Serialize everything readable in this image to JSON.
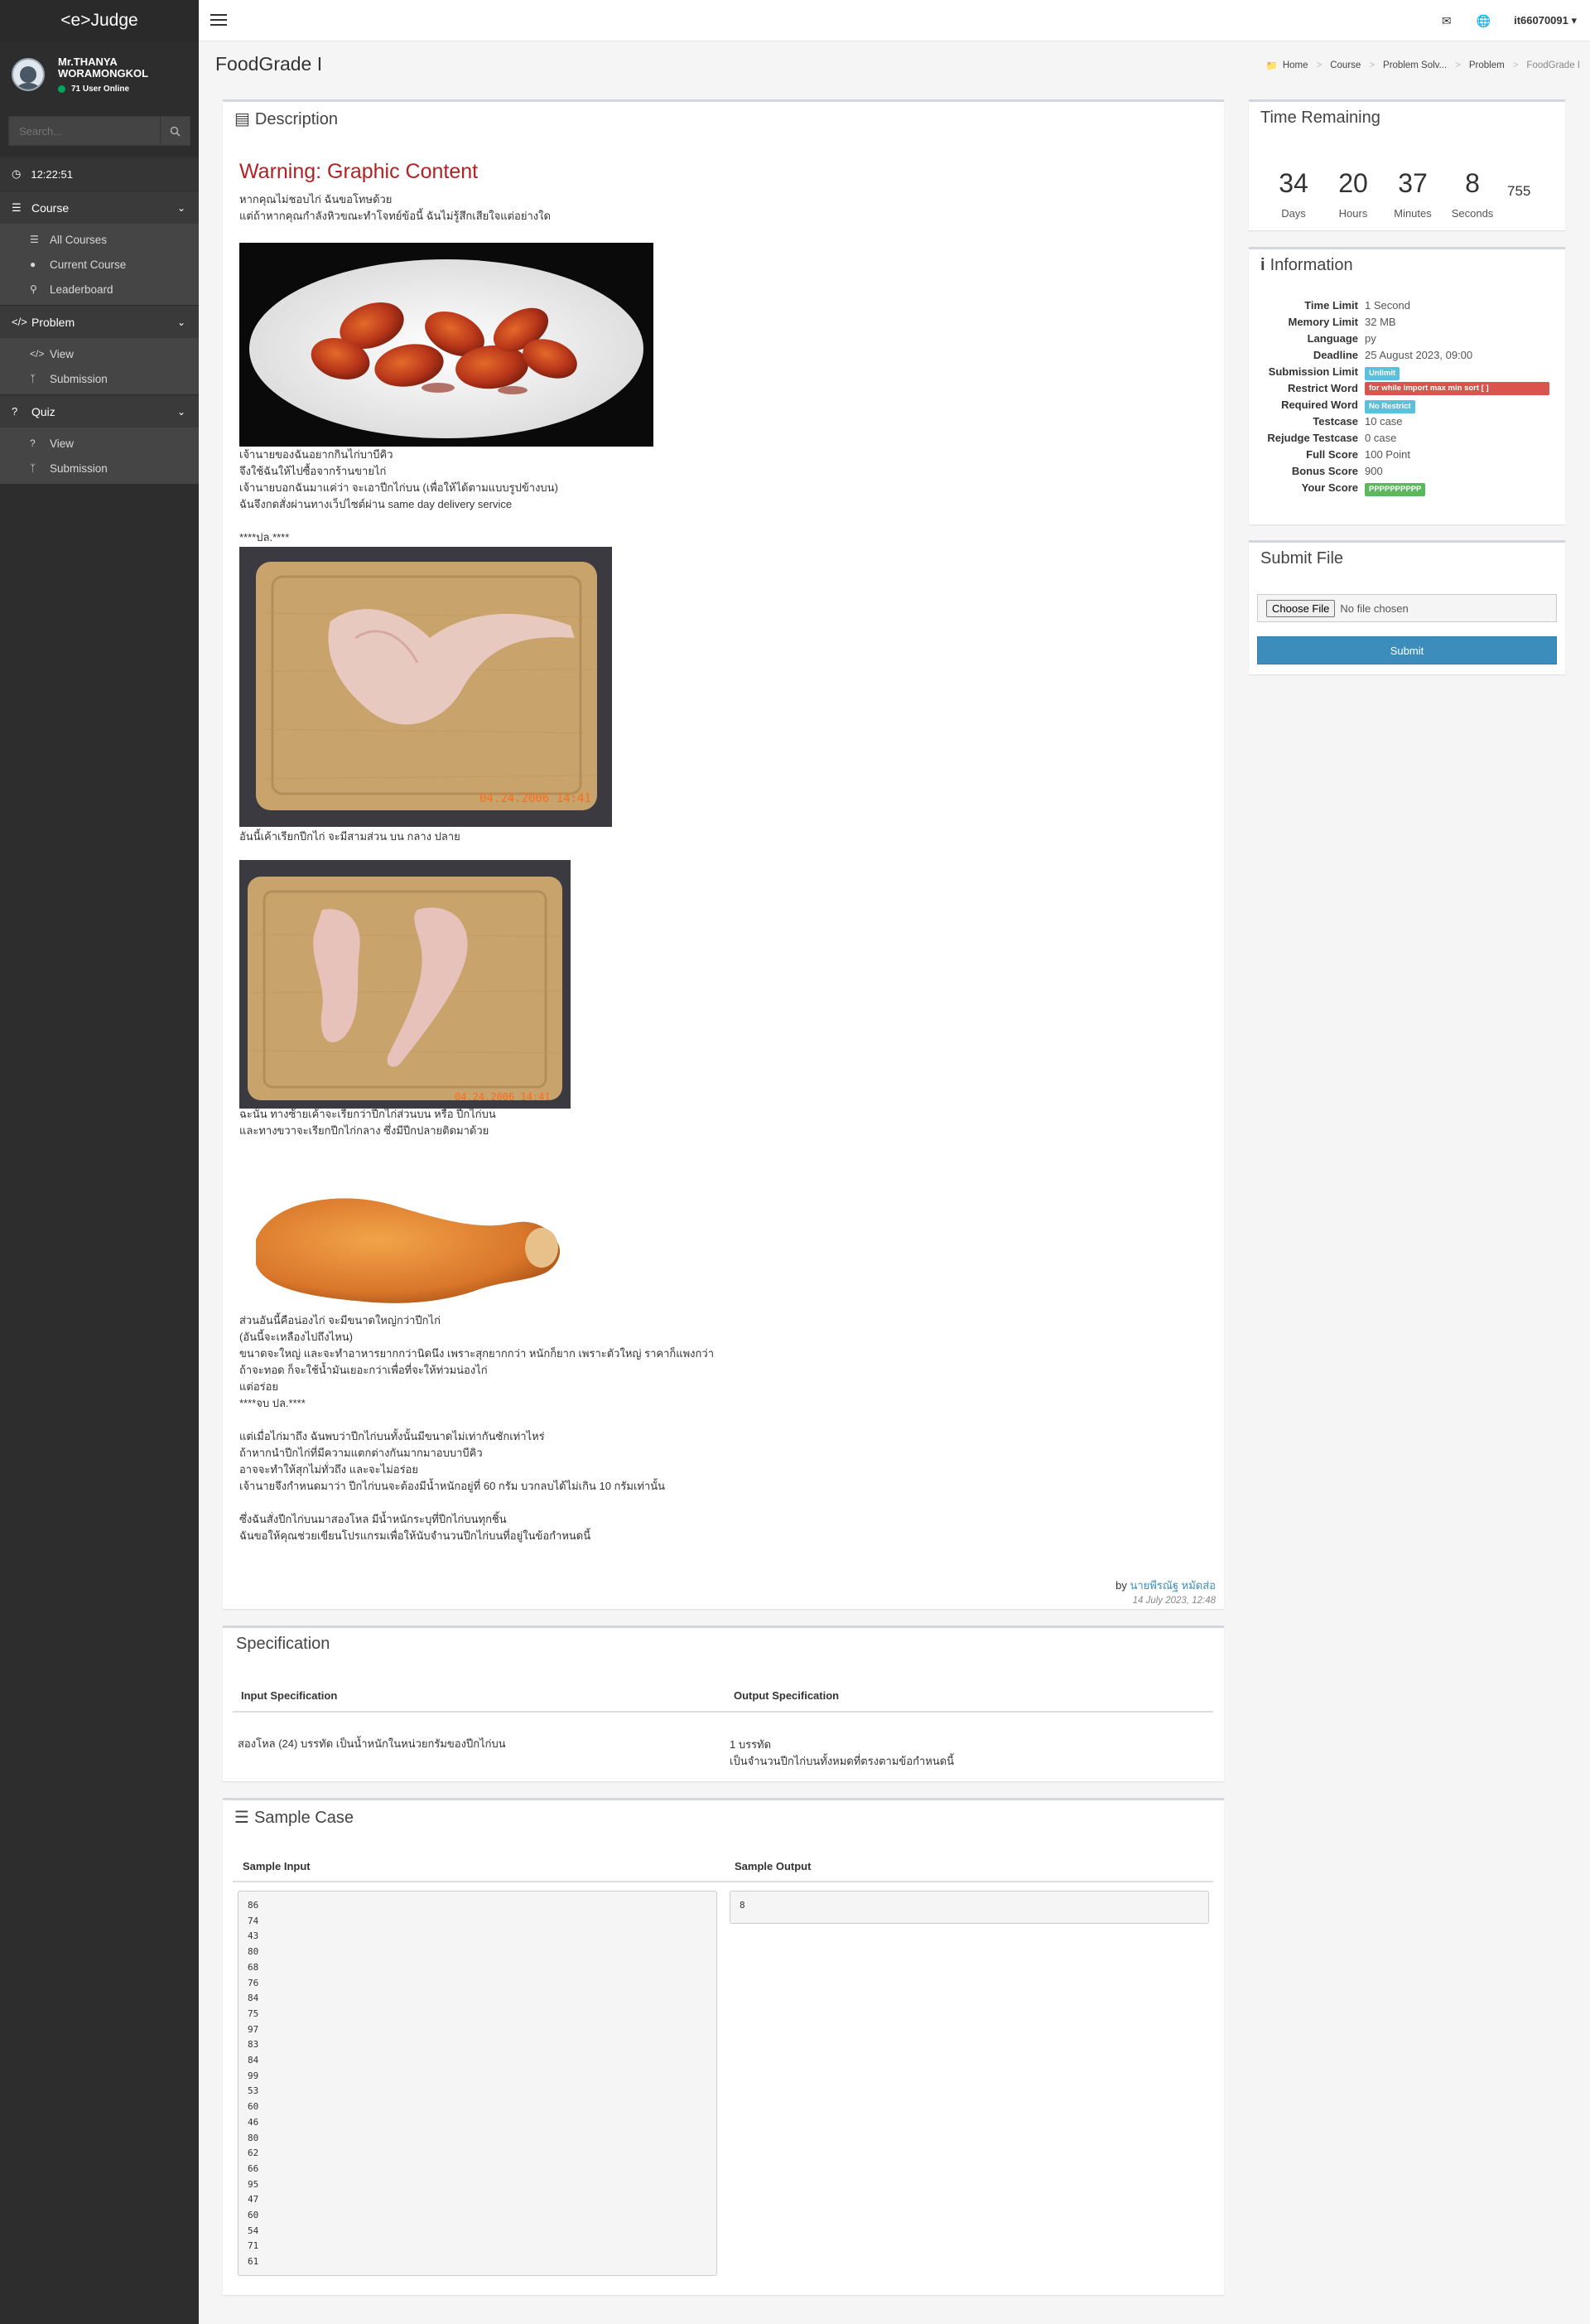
{
  "app": {
    "brand": "<e>Judge",
    "title": "FoodGrade I"
  },
  "user": {
    "name": "Mr.THANYA WORAMONGKOL",
    "online": "71 User Online",
    "username": "it66070091"
  },
  "search": {
    "placeholder": "Search..."
  },
  "clock": "12:22:51",
  "sidebar": {
    "sections": [
      {
        "label": "Course",
        "items": [
          "All Courses",
          "Current Course",
          "Leaderboard"
        ]
      },
      {
        "label": "Problem",
        "items": [
          "View",
          "Submission"
        ]
      },
      {
        "label": "Quiz",
        "items": [
          "View",
          "Submission"
        ]
      }
    ]
  },
  "breadcrumb": [
    "Home",
    "Course",
    "Problem Solv...",
    "Problem",
    "FoodGrade I"
  ],
  "description": {
    "title": "Description",
    "warning": "Warning: Graphic Content",
    "p1": "หากคุณไม่ชอบไก่ ฉันขอโทษด้วย\nแต่ถ้าหากคุณกำลังหิวขณะทำโจทย์ข้อนี้ ฉันไม่รู้สึกเสียใจแต่อย่างใด",
    "p2": "เจ้านายของฉันอยากกินไก่บาบีคิว\nจึงใช้ฉันให้ไปซื้อจากร้านขายไก่\nเจ้านายบอกฉันมาแค่ว่า จะเอาปีกไก่บน (เพื่อให้ได้ตามแบบรูปข้างบน)\nฉันจึงกดสั่งผ่านทางเว็ปไซต์ผ่าน same day delivery service\n\n****ปล.****",
    "p3": "อันนี้เค้าเรียกปีกไก่ จะมีสามส่วน บน กลาง ปลาย",
    "p4": "ฉะนั้น ทางซ้ายเค้าจะเรียกว่าปีกไก่ส่วนบน หรือ ปีกไก่บน\nและทางขวาจะเรียกปีกไก่กลาง ซึ่งมีปีกปลายติดมาด้วย",
    "p5": "ส่วนอันนี้คือน่องไก่ จะมีขนาดใหญ่กว่าปีกไก่\n(อันนี้จะเหลืองไปถึงไหน)\nขนาดจะใหญ่ และจะทำอาหารยากกว่านิดนึง เพราะสุกยากกว่า หนักก็ยาก เพราะตัวใหญ่ ราคาก็แพงกว่า\nถ้าจะทอด ก็จะใช้น้ำมันเยอะกว่าเพื่อที่จะให้ท่วมน่องไก่\nแต่อร่อย\n****จบ ปล.****\n\nแต่เมื่อไก่มาถึง ฉันพบว่าปีกไก่บนทั้งนั้นมีขนาดไม่เท่ากันซักเท่าไหร่\nถ้าหากนำปีกไก่ที่มีความแตกต่างกันมากมาอบบาบีคิว\nอาจจะทำให้สุกไม่ทั่วถึง และจะไม่อร่อย\nเจ้านายจึงกำหนดมาว่า ปีกไก่บนจะต้องมีน้ำหนักอยู่ที่ 60 กรัม บวกลบได้ไม่เกิน 10 กรัมเท่านั้น\n\nซึ่งฉันสั่งปีกไก่บนมาสองโหล มีน้ำหนักระบุที่ปีกไก่บนทุกชิ้น\nฉันขอให้คุณช่วยเขียนโปรแกรมเพื่อให้นับจำนวนปีกไก่บนที่อยู่ในข้อกำหนดนี้",
    "author_prefix": "by",
    "author": "นายพีรณัฐ หมัดส่อ",
    "date": "14 July 2023, 12:48",
    "photo_stamp": "04.24.2006 14:41"
  },
  "specification": {
    "title": "Specification",
    "input_header": "Input Specification",
    "output_header": "Output Specification",
    "input": "สองโหล (24) บรรทัด เป็นน้ำหนักในหน่วยกรัมของปีกไก่บน",
    "output": "1 บรรทัด\nเป็นจำนวนปีกไก่บนทั้งหมดที่ตรงตามข้อกำหนดนี้"
  },
  "sample": {
    "title": "Sample Case",
    "input_header": "Sample Input",
    "output_header": "Sample Output",
    "input": "86\n74\n43\n80\n68\n76\n84\n75\n97\n83\n84\n99\n53\n60\n46\n80\n62\n66\n95\n47\n60\n54\n71\n61",
    "output": "8"
  },
  "timer": {
    "title": "Time Remaining",
    "days": "34",
    "hours": "20",
    "minutes": "37",
    "seconds": "8",
    "ms": "755",
    "labels": {
      "days": "Days",
      "hours": "Hours",
      "minutes": "Minutes",
      "seconds": "Seconds"
    }
  },
  "information": {
    "title": "Information",
    "rows": [
      {
        "k": "Time Limit",
        "v": "1 Second"
      },
      {
        "k": "Memory Limit",
        "v": "32 MB"
      },
      {
        "k": "Language",
        "v": "py"
      },
      {
        "k": "Deadline",
        "v": "25 August 2023, 09:00"
      },
      {
        "k": "Submission Limit",
        "badge": "Unlimit",
        "color": "#5bc0de"
      },
      {
        "k": "Restrict Word",
        "badge": "for while import max min sort [ ]",
        "color": "#d9534f"
      },
      {
        "k": "Required Word",
        "badge": "No Restrict",
        "color": "#5bc0de"
      },
      {
        "k": "Testcase",
        "v": "10 case"
      },
      {
        "k": "Rejudge Testcase",
        "v": "0 case"
      },
      {
        "k": "Full Score",
        "v": "100 Point"
      },
      {
        "k": "Bonus Score",
        "v": "900"
      },
      {
        "k": "Your Score",
        "badge": "PPPPPPPPPP",
        "color": "#5cb85c"
      }
    ]
  },
  "submit": {
    "title": "Submit File",
    "choose": "Choose File",
    "no_file": "No file chosen",
    "button": "Submit"
  }
}
